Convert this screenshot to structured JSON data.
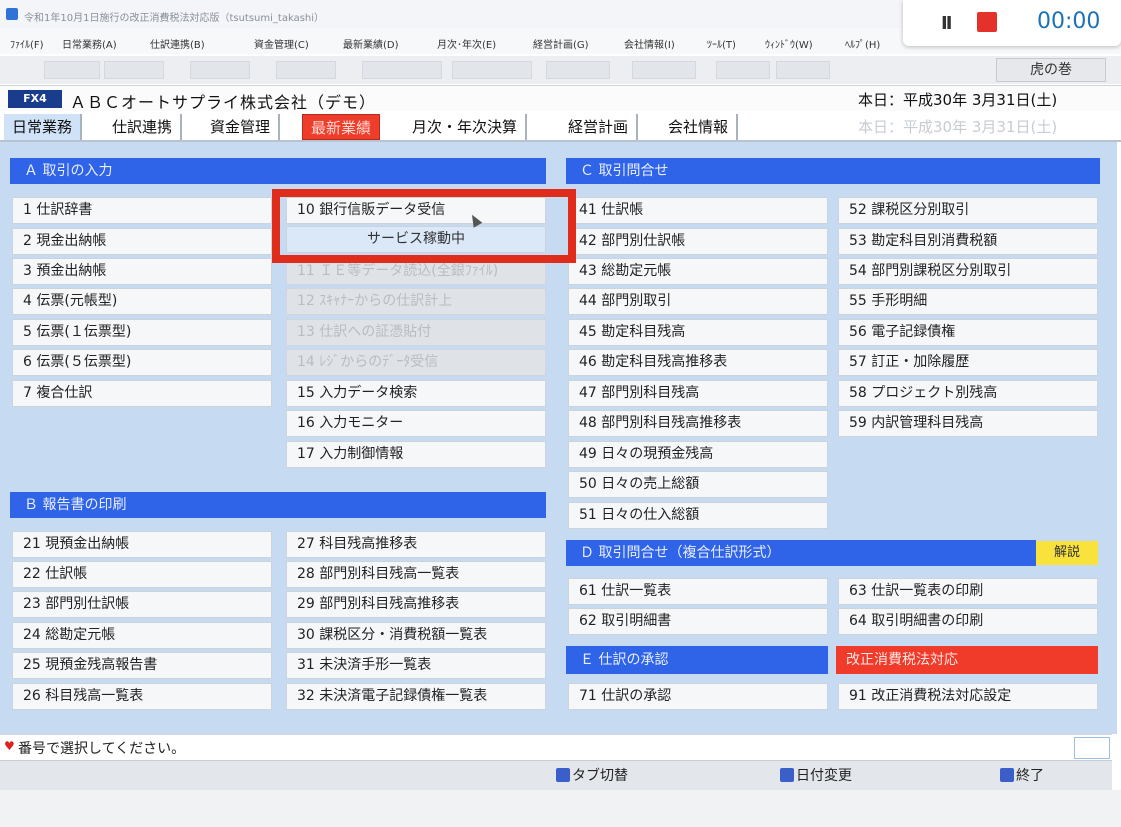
{
  "window": {
    "title": "令和1年10月1日施行の改正消費税法対応版（tsutsumi_takashi）"
  },
  "menu": [
    "ﾌｧｲﾙ(F)",
    "日常業務(A)",
    "仕訳連携(B)",
    "資金管理(C)",
    "最新業績(D)",
    "月次･年次(E)",
    "経営計画(G)",
    "会社情報(I)",
    "ﾂｰﾙ(T)",
    "ｳｨﾝﾄﾞｳ(W)",
    "ﾍﾙﾌﾟ(H)"
  ],
  "recorder": {
    "time": "00:00",
    "pause_glyph": "II"
  },
  "toranomaki": "虎の巻",
  "company": {
    "badge": "FX4",
    "name": "ＡＢＣオートサプライ株式会社（デモ）",
    "today": "本日：平成30年 3月31日(土)"
  },
  "tabs": [
    "日常業務",
    "仕訳連携",
    "資金管理",
    "最新業績",
    "月次・年次決算",
    "経営計画",
    "会社情報"
  ],
  "sections": {
    "a": {
      "header": "Ａ 取引の入力",
      "col1": [
        "1 仕訳辞書",
        "2 現金出納帳",
        "3 預金出納帳",
        "4 伝票(元帳型)",
        "5 伝票(１伝票型)",
        "6 伝票(５伝票型)",
        "7 複合仕訳"
      ],
      "col2": [
        "10 銀行信販データ受信",
        "サービス稼動中",
        "11 ＩＥ等データ読込(全銀ﾌｧｲﾙ)",
        "12 ｽｷｬﾅｰからの仕訳計上",
        "13 仕訳への証憑貼付",
        "14 ﾚｼﾞからのﾃﾞｰﾀ受信",
        "15 入力データ検索",
        "16 入力モニター",
        "17 入力制御情報"
      ]
    },
    "b": {
      "header": "Ｂ 報告書の印刷",
      "col1": [
        "21 現預金出納帳",
        "22 仕訳帳",
        "23 部門別仕訳帳",
        "24 総勘定元帳",
        "25 現預金残高報告書",
        "26 科目残高一覧表"
      ],
      "col2": [
        "27 科目残高推移表",
        "28 部門別科目残高一覧表",
        "29 部門別科目残高推移表",
        "30 課税区分・消費税額一覧表",
        "31 未決済手形一覧表",
        "32 未決済電子記録債権一覧表"
      ]
    },
    "c": {
      "header": "Ｃ 取引問合せ",
      "col1": [
        "41 仕訳帳",
        "42 部門別仕訳帳",
        "43 総勘定元帳",
        "44 部門別取引",
        "45 勘定科目残高",
        "46 勘定科目残高推移表",
        "47 部門別科目残高",
        "48 部門別科目残高推移表",
        "49 日々の現預金残高",
        "50 日々の売上総額",
        "51 日々の仕入総額"
      ],
      "col2": [
        "52 課税区分別取引",
        "53 勘定科目別消費税額",
        "54 部門別課税区分別取引",
        "55 手形明細",
        "56 電子記録債権",
        "57 訂正・加除履歴",
        "58 プロジェクト別残高",
        "59 内訳管理科目残高"
      ]
    },
    "d": {
      "header": "Ｄ 取引問合せ（複合仕訳形式）",
      "kaisetsu": "解説",
      "col1": [
        "61 仕訳一覧表",
        "62 取引明細書"
      ],
      "col2": [
        "63 仕訳一覧表の印刷",
        "64 取引明細書の印刷"
      ]
    },
    "e": {
      "header": "Ｅ 仕訳の承認",
      "items": [
        "71 仕訳の承認"
      ]
    },
    "tax": {
      "header": "改正消費税法対応",
      "items": [
        "91 改正消費税法対応設定"
      ]
    }
  },
  "status": {
    "message": "番号で選択してください。"
  },
  "fkeys": [
    {
      "label": "タブ切替"
    },
    {
      "label": "日付変更"
    },
    {
      "label": "終了"
    }
  ]
}
